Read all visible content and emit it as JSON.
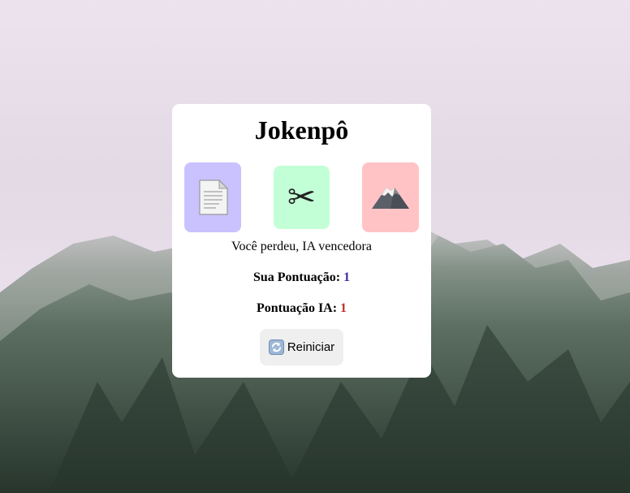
{
  "page": {
    "background_description_colors": {
      "sky": "#ece2ee",
      "fog": "#d8d0da",
      "mountain_dark": "#2e3c33",
      "mountain_mid": "#5f6f66"
    }
  },
  "game": {
    "title": "Jokenpô",
    "choices": [
      {
        "name": "paper",
        "icon": "page-document-icon",
        "color": "#c9c2ff"
      },
      {
        "name": "scissors",
        "icon": "scissors-icon",
        "glyph": "✂",
        "color": "#c3ffd6"
      },
      {
        "name": "rock",
        "icon": "mountain-icon",
        "color": "#ffc3c6"
      }
    ],
    "result_text": "Você perdeu, IA vencedora",
    "user_score_label": "Sua Pontuação:",
    "user_score_value": "1",
    "ai_score_label": "Pontuação IA:",
    "ai_score_value": "1",
    "restart_label": "Reiniciar",
    "restart_icon": "refresh-icon"
  }
}
